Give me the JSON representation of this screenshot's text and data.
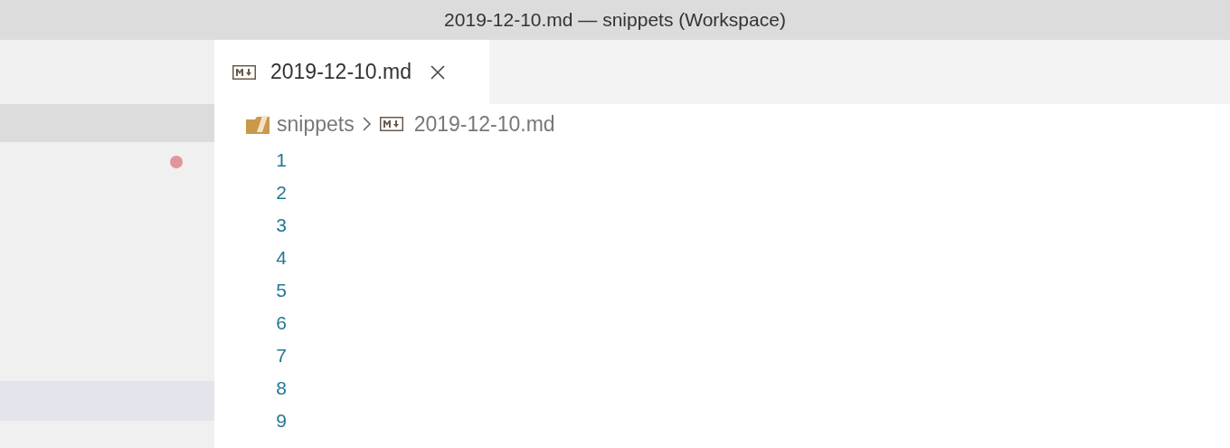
{
  "window": {
    "title": "2019-12-10.md — snippets (Workspace)"
  },
  "tabs": [
    {
      "label": "2019-12-10.md",
      "selected": true
    }
  ],
  "breadcrumb": [
    "snippets",
    "2019-12-10.md"
  ],
  "editor": {
    "line_numbers": [
      "1",
      "2",
      "3",
      "4",
      "5",
      "6",
      "7",
      "8",
      "9"
    ]
  }
}
